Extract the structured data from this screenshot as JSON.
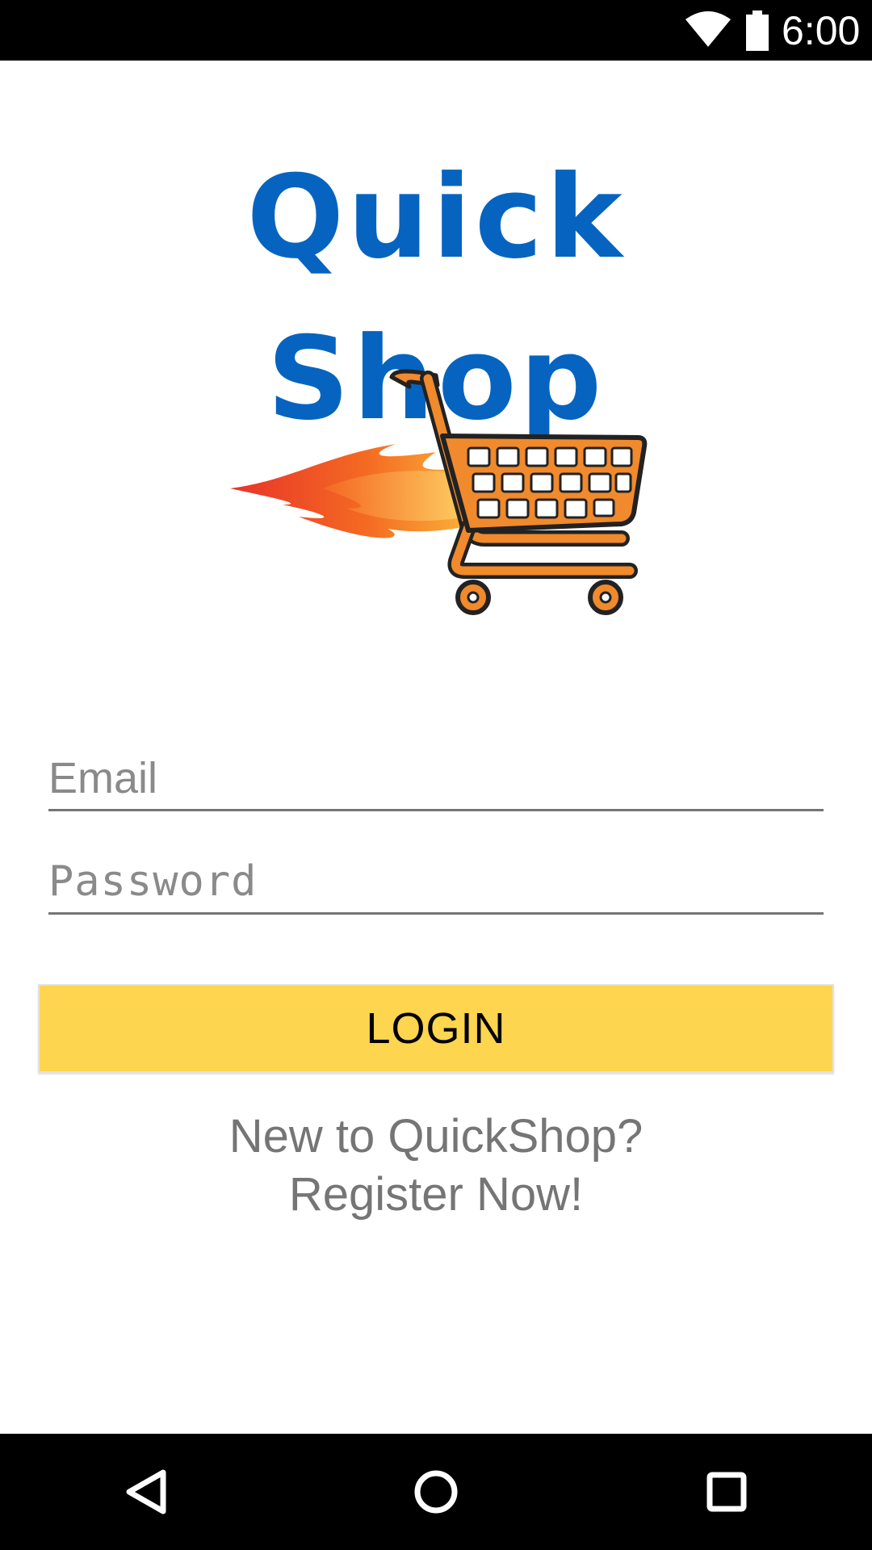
{
  "status_bar": {
    "time": "6:00",
    "icons": [
      "wifi-icon",
      "battery-icon"
    ]
  },
  "logo": {
    "text": "Quick Shop",
    "color": "#0664c0"
  },
  "illustration": {
    "icon": "fast-shopping-cart-icon",
    "cart_color": "#f08a2c"
  },
  "form": {
    "email_placeholder": "Email",
    "email_value": "",
    "password_placeholder": "Password",
    "password_value": ""
  },
  "login_button": {
    "label": "LOGIN",
    "color": "#fdd54e"
  },
  "register": {
    "line1": "New to QuickShop?",
    "line2": "Register Now!"
  },
  "nav_bar": {
    "icons": [
      "back-icon",
      "home-icon",
      "recents-icon"
    ]
  }
}
